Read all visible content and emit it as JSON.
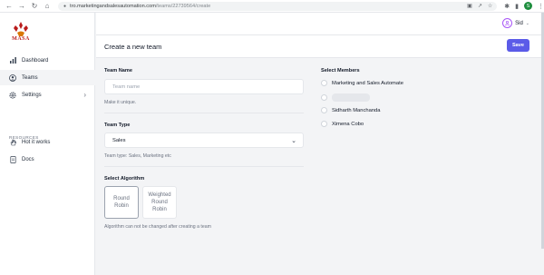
{
  "browser": {
    "url_domain": "tro.marketingandsalesautomation.com",
    "url_path": "/teams/22739564/create",
    "profile_initial": "S"
  },
  "brand": {
    "logo_text": "MASA"
  },
  "sidebar": {
    "items": [
      {
        "label": "Dashboard",
        "icon": "bar-chart-icon"
      },
      {
        "label": "Teams",
        "icon": "user-circle-icon",
        "active": true
      },
      {
        "label": "Settings",
        "icon": "gear-icon"
      }
    ],
    "resources_label": "RESOURCES",
    "resources": [
      {
        "label": "Hot it works",
        "icon": "hand-icon"
      },
      {
        "label": "Docs",
        "icon": "document-icon"
      }
    ]
  },
  "header": {
    "user_name": "Sid"
  },
  "page": {
    "title": "Create a new team",
    "save_label": "Save"
  },
  "form": {
    "team_name": {
      "label": "Team Name",
      "placeholder": "Team name",
      "value": "",
      "help": "Make it unique."
    },
    "team_type": {
      "label": "Team Type",
      "selected": "Sales",
      "help": "Team type: Sales, Marketing etc"
    },
    "algorithm": {
      "label": "Select Algorithm",
      "options": [
        {
          "line1": "Round",
          "line2": "Robin",
          "line3": ""
        },
        {
          "line1": "Weighted",
          "line2": "Round",
          "line3": "Robin"
        }
      ],
      "help": "Algorithm can not be changed after creating a team"
    }
  },
  "members": {
    "label": "Select Members",
    "items": [
      "Marketing and Sales Automate",
      "",
      "Sidharth Manchanda",
      "Ximena Cobo"
    ]
  },
  "colors": {
    "accent": "#5b5be8",
    "brand_red": "#b91c1c"
  }
}
